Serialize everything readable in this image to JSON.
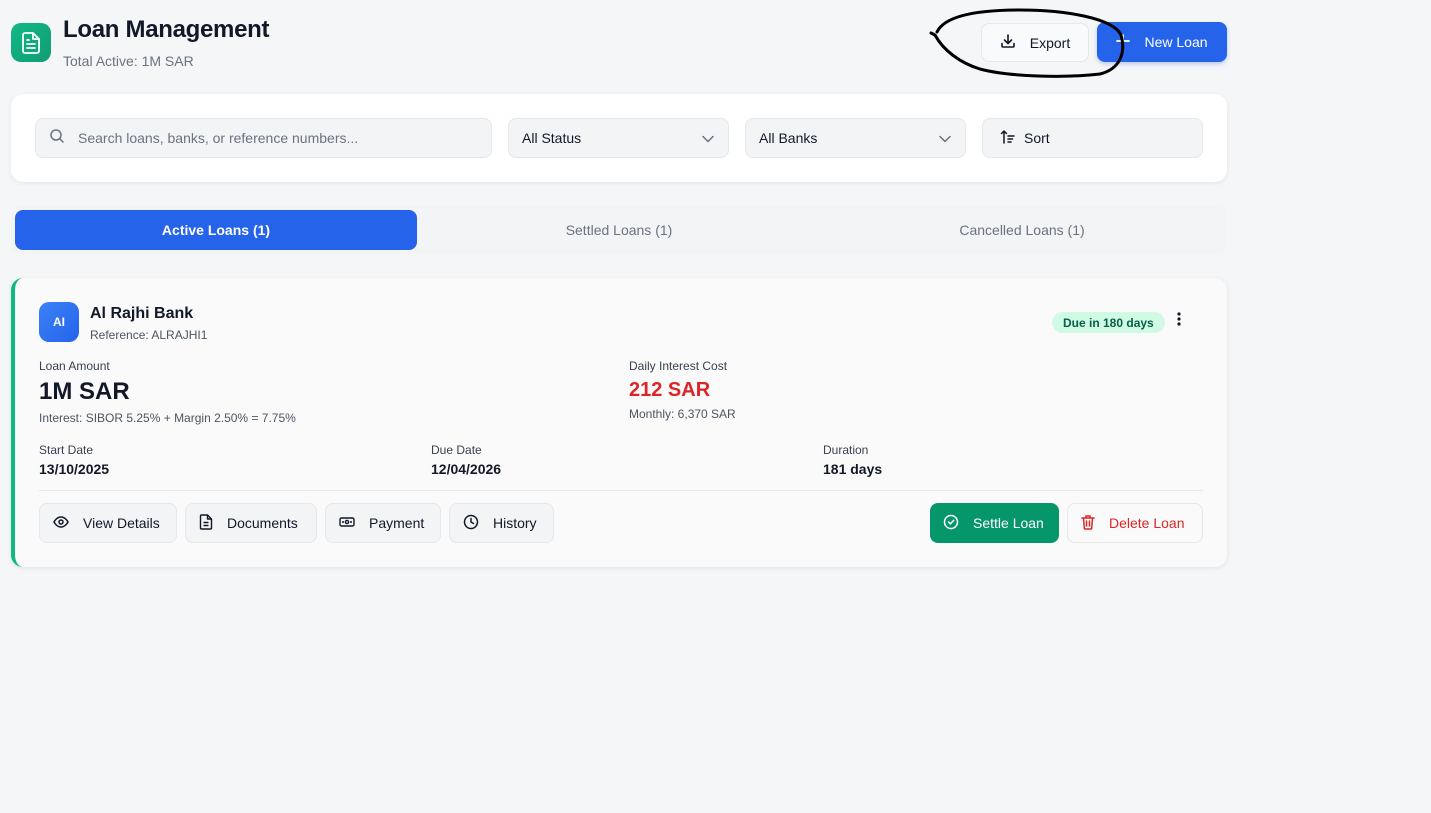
{
  "header": {
    "title": "Loan Management",
    "subtitle": "Total Active: 1M SAR",
    "export_label": "Export",
    "new_loan_label": "New Loan"
  },
  "filters": {
    "search_placeholder": "Search loans, banks, or reference numbers...",
    "status_selected": "All Status",
    "bank_selected": "All Banks",
    "sort_label": "Sort"
  },
  "tabs": [
    {
      "label": "Active Loans (1)",
      "active": true
    },
    {
      "label": "Settled Loans (1)",
      "active": false
    },
    {
      "label": "Cancelled Loans (1)",
      "active": false
    }
  ],
  "loan": {
    "avatar_initials": "AI",
    "bank_name": "Al Rajhi Bank",
    "reference": "Reference: ALRAJHI1",
    "due_badge": "Due in 180 days",
    "loan_amount_label": "Loan Amount",
    "loan_amount": "1M SAR",
    "interest_text": "Interest: SIBOR 5.25% + Margin 2.50% = 7.75%",
    "daily_cost_label": "Daily Interest Cost",
    "daily_cost": "212 SAR",
    "monthly_text": "Monthly: 6,370 SAR",
    "start_date_label": "Start Date",
    "start_date": "13/10/2025",
    "due_date_label": "Due Date",
    "due_date": "12/04/2026",
    "duration_label": "Duration",
    "duration": "181 days",
    "actions": {
      "view_details": "View Details",
      "documents": "Documents",
      "payment": "Payment",
      "history": "History",
      "settle": "Settle Loan",
      "delete": "Delete Loan"
    }
  },
  "colors": {
    "primary": "#2563eb",
    "success": "#059669",
    "danger": "#dc2626",
    "accent_border": "#10b981"
  }
}
